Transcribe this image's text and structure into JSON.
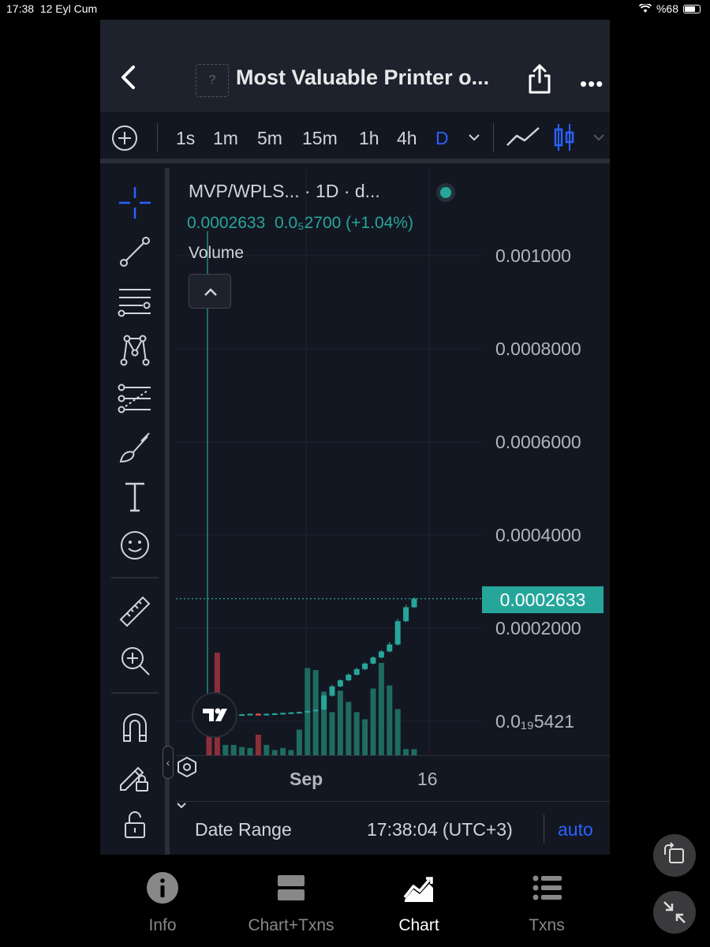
{
  "status_bar": {
    "time": "17:38",
    "date": "12 Eyl Cum",
    "battery": "%68"
  },
  "header": {
    "title": "Most Valuable Printer o..."
  },
  "toolbar": {
    "intervals": [
      "1s",
      "1m",
      "5m",
      "15m",
      "1h",
      "4h",
      "D"
    ],
    "active_interval": "D"
  },
  "chart": {
    "legend": "MVP/WPLS... · 1D · d...",
    "ohlc_price": "0.0002633",
    "ohlc_change_value": "0.0₅2700",
    "ohlc_change_pct": "(+1.04%)",
    "volume_label": "Volume",
    "y_labels": [
      "0.001000",
      "0.0008000",
      "0.0006000",
      "0.0004000",
      "0.0002000",
      "0.0₁₉5421"
    ],
    "current_price_tag": "0.0002633",
    "x_labels": [
      "Sep",
      "16"
    ]
  },
  "bottom_bar": {
    "date_range": "Date Range",
    "time": "17:38:04 (UTC+3)",
    "scale": "auto"
  },
  "nav": {
    "items": [
      "Info",
      "Chart+Txns",
      "Chart",
      "Txns"
    ],
    "active": "Chart"
  },
  "chart_data": {
    "type": "candlestick",
    "y_axis_labels": [
      "0.001000",
      "0.0008000",
      "0.0006000",
      "0.0004000",
      "0.0002000",
      "0.0₁₉5421"
    ],
    "x_axis_labels": [
      "Sep",
      "16"
    ],
    "last_price": 0.0002633,
    "candles": [
      {
        "dir": "down",
        "open": 4.5e-05,
        "close": 3.8e-05,
        "high": 4.8e-05,
        "low": 3.5e-05
      },
      {
        "dir": "down",
        "open": 3.4e-05,
        "close": 1.2e-05,
        "high": 3.6e-05,
        "low": 1e-05
      },
      {
        "dir": "up",
        "open": 1.2e-05,
        "close": 1.3e-05,
        "high": 1.4e-05,
        "low": 1.1e-05
      },
      {
        "dir": "up",
        "open": 1.3e-05,
        "close": 1.4e-05,
        "high": 1.5e-05,
        "low": 1.2e-05
      },
      {
        "dir": "up",
        "open": 1.4e-05,
        "close": 1.5e-05,
        "high": 1.6e-05,
        "low": 1.3e-05
      },
      {
        "dir": "up",
        "open": 1.5e-05,
        "close": 1.6e-05,
        "high": 1.7e-05,
        "low": 1.4e-05
      },
      {
        "dir": "down",
        "open": 1.6e-05,
        "close": 1.5e-05,
        "high": 1.7e-05,
        "low": 1.4e-05
      },
      {
        "dir": "up",
        "open": 1.5e-05,
        "close": 1.6e-05,
        "high": 1.7e-05,
        "low": 1.4e-05
      },
      {
        "dir": "up",
        "open": 1.6e-05,
        "close": 1.7e-05,
        "high": 1.8e-05,
        "low": 1.5e-05
      },
      {
        "dir": "up",
        "open": 1.7e-05,
        "close": 1.8e-05,
        "high": 1.9e-05,
        "low": 1.6e-05
      },
      {
        "dir": "up",
        "open": 1.8e-05,
        "close": 1.9e-05,
        "high": 2e-05,
        "low": 1.7e-05
      },
      {
        "dir": "up",
        "open": 1.9e-05,
        "close": 2e-05,
        "high": 2.1e-05,
        "low": 1.8e-05
      },
      {
        "dir": "up",
        "open": 2e-05,
        "close": 2.2e-05,
        "high": 2.3e-05,
        "low": 1.9e-05
      },
      {
        "dir": "up",
        "open": 2.2e-05,
        "close": 2.5e-05,
        "high": 2.6e-05,
        "low": 2.1e-05
      },
      {
        "dir": "up",
        "open": 2.5e-05,
        "close": 5.5e-05,
        "high": 5.8e-05,
        "low": 2.4e-05
      },
      {
        "dir": "up",
        "open": 5.5e-05,
        "close": 7.5e-05,
        "high": 7.8e-05,
        "low": 5.3e-05
      },
      {
        "dir": "up",
        "open": 7.5e-05,
        "close": 8.8e-05,
        "high": 9e-05,
        "low": 7.3e-05
      },
      {
        "dir": "up",
        "open": 8.8e-05,
        "close": 0.0001,
        "high": 0.000103,
        "low": 8.6e-05
      },
      {
        "dir": "up",
        "open": 0.0001,
        "close": 0.000112,
        "high": 0.000115,
        "low": 9.8e-05
      },
      {
        "dir": "up",
        "open": 0.000112,
        "close": 0.000124,
        "high": 0.000127,
        "low": 0.00011
      },
      {
        "dir": "up",
        "open": 0.000124,
        "close": 0.000137,
        "high": 0.00014,
        "low": 0.000122
      },
      {
        "dir": "up",
        "open": 0.000137,
        "close": 0.00015,
        "high": 0.000153,
        "low": 0.000135
      },
      {
        "dir": "up",
        "open": 0.00015,
        "close": 0.000165,
        "high": 0.00017,
        "low": 0.000148
      },
      {
        "dir": "up",
        "open": 0.000165,
        "close": 0.000215,
        "high": 0.00022,
        "low": 0.000163
      },
      {
        "dir": "up",
        "open": 0.000215,
        "close": 0.000245,
        "high": 0.00025,
        "low": 0.000213
      },
      {
        "dir": "up",
        "open": 0.000245,
        "close": 0.0002633,
        "high": 0.000266,
        "low": 0.000243
      }
    ],
    "volume_relative": [
      0.28,
      1.0,
      0.1,
      0.1,
      0.08,
      0.07,
      0.2,
      0.1,
      0.05,
      0.07,
      0.05,
      0.25,
      0.85,
      0.83,
      0.62,
      0.42,
      0.63,
      0.52,
      0.42,
      0.35,
      0.65,
      0.9,
      0.68,
      0.45,
      0.06,
      0.06
    ]
  }
}
